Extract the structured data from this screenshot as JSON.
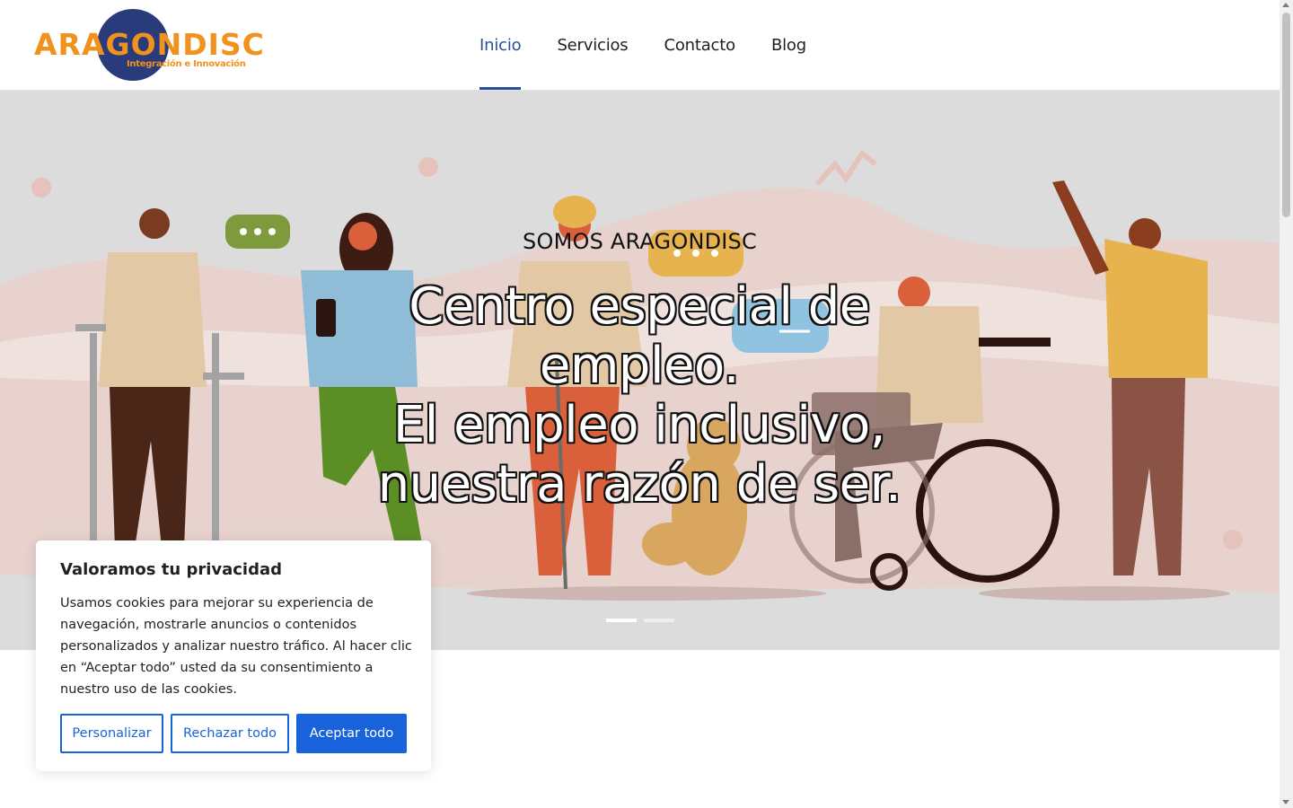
{
  "brand": {
    "name": "ARAGONDISC",
    "tagline": "Integración e Innovación"
  },
  "nav": {
    "items": [
      {
        "label": "Inicio",
        "active": true
      },
      {
        "label": "Servicios",
        "active": false
      },
      {
        "label": "Contacto",
        "active": false
      },
      {
        "label": "Blog",
        "active": false
      }
    ]
  },
  "hero": {
    "kicker": "SOMOS ARAGONDISC",
    "title_line1": "Centro especial de empleo.",
    "title_line2": "El empleo inclusivo, nuestra razón de ser.",
    "slides": [
      {
        "active": true
      },
      {
        "active": false
      }
    ]
  },
  "cookie_banner": {
    "title": "Valoramos tu privacidad",
    "text": "Usamos cookies para mejorar su experiencia de navegación, mostrarle anuncios o contenidos personalizados y analizar nuestro tráfico. Al hacer clic en “Aceptar todo” usted da su consentimiento a nuestro uso de las cookies.",
    "customize_label": "Personalizar",
    "reject_label": "Rechazar todo",
    "accept_label": "Aceptar todo"
  },
  "colors": {
    "brand_orange": "#f0921d",
    "brand_navy": "#2a3b7c",
    "nav_active": "#2a4f9a",
    "cookie_blue": "#1863dc",
    "hero_bg": "#dcdcdc"
  }
}
